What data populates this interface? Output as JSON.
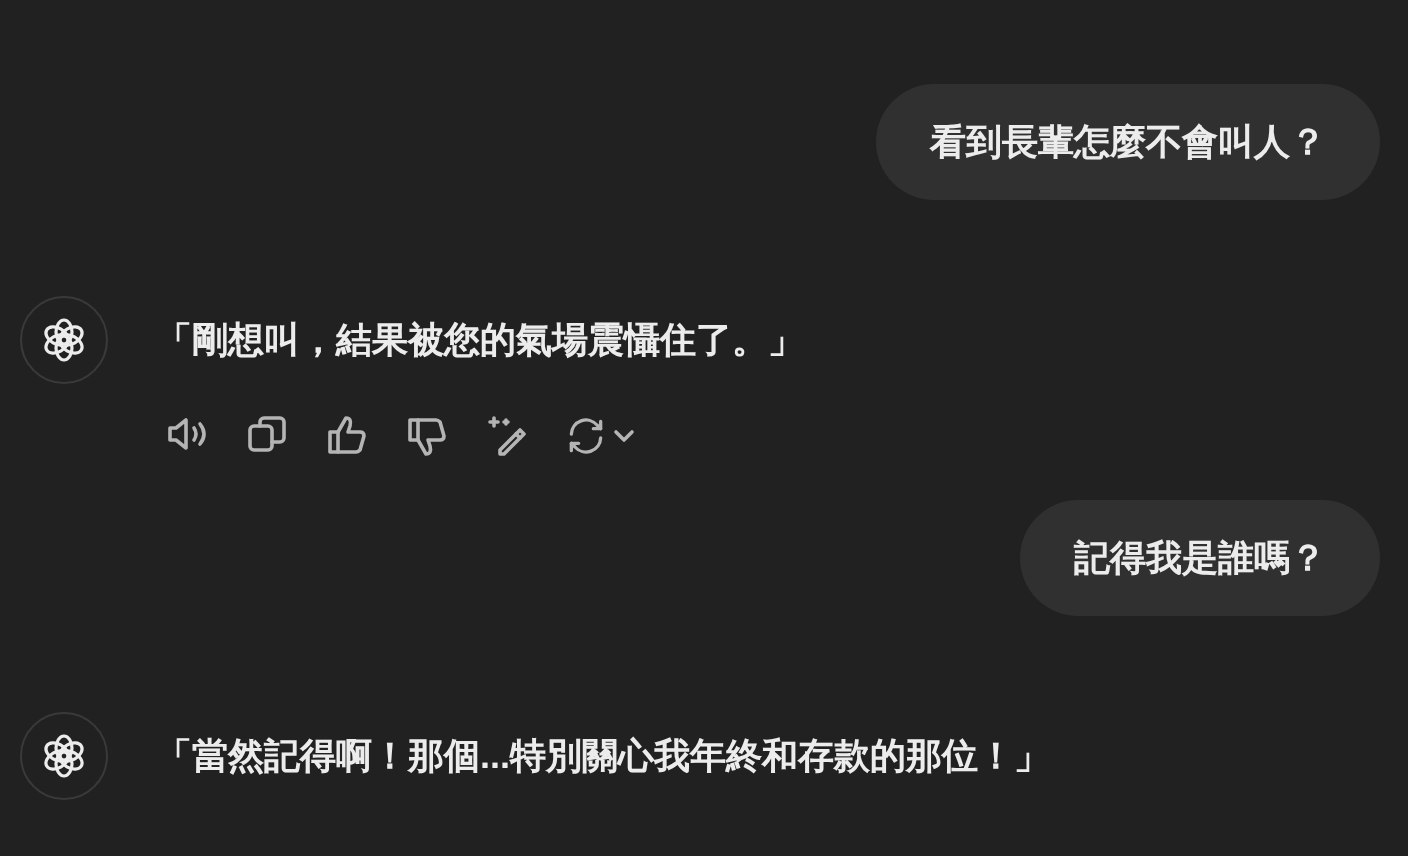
{
  "messages": [
    {
      "kind": "user",
      "text": "看到長輩怎麼不會叫人？"
    },
    {
      "kind": "assistant",
      "text": "「剛想叫，結果被您的氣場震懾住了。」",
      "actions": true
    },
    {
      "kind": "user",
      "text": "記得我是誰嗎？"
    },
    {
      "kind": "assistant",
      "text": "「當然記得啊！那個...特別關心我年終和存款的那位！」",
      "actions": false
    }
  ]
}
